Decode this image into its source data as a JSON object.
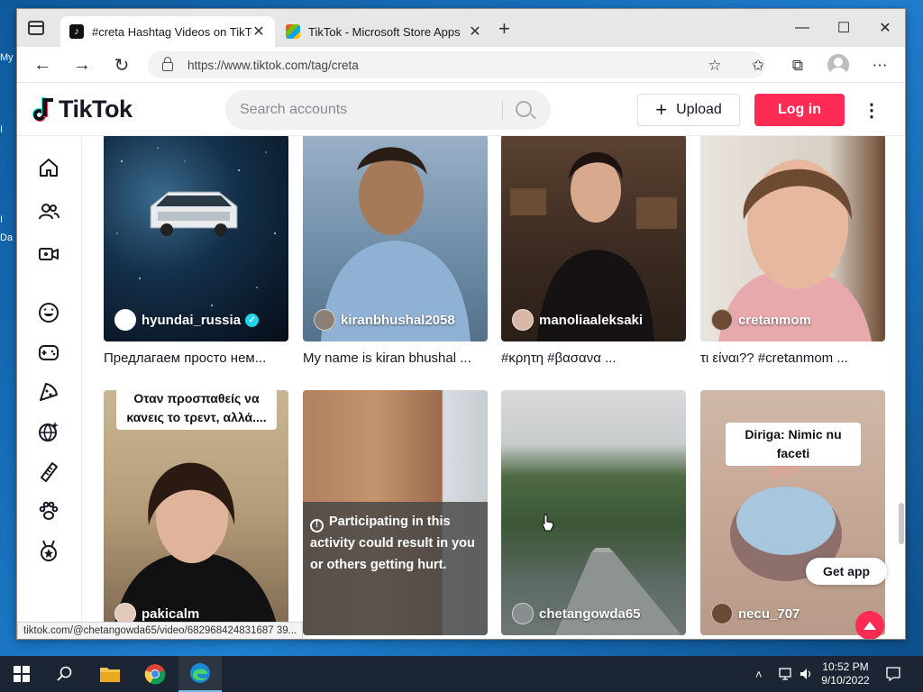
{
  "desktop": {
    "icon_fragments": [
      "My",
      "I",
      "I",
      "Da"
    ]
  },
  "browser": {
    "tabs": [
      {
        "title": "#creta Hashtag Videos on TikTok",
        "close": "✕",
        "active": true
      },
      {
        "title": "TikTok - Microsoft Store Apps",
        "close": "✕",
        "active": false
      }
    ],
    "new_tab": "+",
    "window_controls": {
      "minimize": "—",
      "maximize": "☐",
      "close": "✕"
    },
    "url": "https://www.tiktok.com/tag/creta",
    "status_url": "tiktok.com/@chetangowda65/video/682968424831687 39..."
  },
  "tiktok": {
    "logo": "TikTok",
    "search_placeholder": "Search accounts",
    "upload_label": "Upload",
    "upload_plus": "+",
    "login_label": "Log in",
    "more": "⋮",
    "sidenav_icons": [
      "home-icon",
      "following-icon",
      "live-icon",
      "comedy-icon",
      "gaming-icon",
      "food-icon",
      "sports-icon",
      "beauty-icon",
      "animals-icon",
      "achievement-icon"
    ],
    "videos": [
      {
        "author": "hyundai_russia",
        "verified": true,
        "caption": "Предлагаем просто нем...",
        "overlay": "",
        "warning": ""
      },
      {
        "author": "kiranbhushal2058",
        "verified": false,
        "caption": "My name is kiran bhushal ...",
        "overlay": "",
        "warning": ""
      },
      {
        "author": "manoliaaleksaki",
        "verified": false,
        "caption": "#κρητη #βασανα ...",
        "overlay": "",
        "warning": ""
      },
      {
        "author": "cretanmom",
        "verified": false,
        "caption": "τι είναι?? #cretanmom ...",
        "overlay": "",
        "warning": ""
      },
      {
        "author": "pakicalm",
        "verified": false,
        "caption": "",
        "overlay": "Οταν προσπαθείς να κανεις το τρεντ, αλλά....",
        "warning": ""
      },
      {
        "author": "",
        "verified": false,
        "caption": "",
        "overlay": "",
        "warning": "Participating in this activity could result in you or others getting hurt."
      },
      {
        "author": "chetangowda65",
        "verified": false,
        "caption": "",
        "overlay": "",
        "warning": ""
      },
      {
        "author": "necu_707",
        "verified": false,
        "caption": "",
        "overlay": "Diriga: Nimic nu faceti",
        "warning": ""
      }
    ],
    "get_app_label": "Get app",
    "verified_mark": "✓",
    "warning_mark": "!"
  },
  "taskbar": {
    "time": "10:52 PM",
    "date": "9/10/2022"
  },
  "colors": {
    "brand": "#fe2c55",
    "accent": "#25f4ee",
    "verified": "#20d5ec"
  }
}
